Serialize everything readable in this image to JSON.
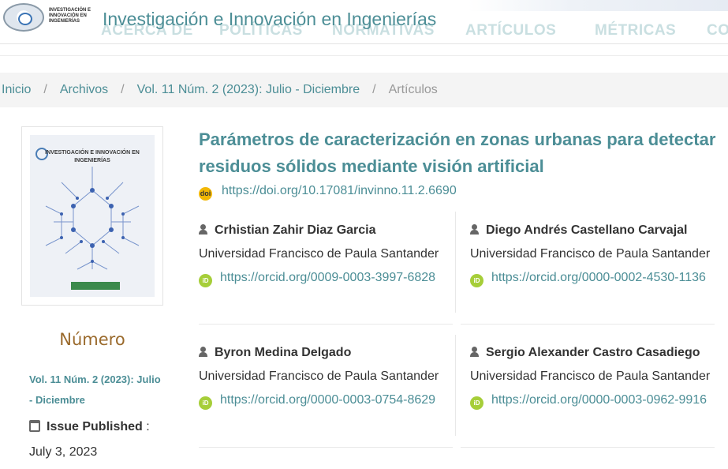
{
  "header": {
    "logo_text": "INVESTIGACIÓN E INNOVACIÓN EN INGENIERÍAS",
    "site_title": "Investigación e Innovación en Ingenierías",
    "nav": [
      "ACERCA DE",
      "POLÍTICAS",
      "NORMATIVAS",
      "ARTÍCULOS",
      "MÉTRICAS",
      "CO"
    ]
  },
  "breadcrumb": {
    "items": [
      "Inicio",
      "Archivos",
      "Vol. 11 Núm. 2 (2023): Julio - Diciembre"
    ],
    "separator": "/",
    "current": "Artículos"
  },
  "sidebar": {
    "cover_title": "INVESTIGACIÓN E INNOVACIÓN EN INGENIERÍAS",
    "issue_heading": "Número",
    "issue_link": "Vol. 11 Núm. 2 (2023): Julio - Diciembre",
    "published_label": "Issue Published",
    "published_colon": ":",
    "published_date": "July 3, 2023"
  },
  "article": {
    "title": "Parámetros de caracterización en zonas urbanas para detectar residuos sólidos mediante visión artificial",
    "doi": "https://doi.org/10.17081/invinno.11.2.6690",
    "doi_icon": "doi",
    "orcid_icon": "iD",
    "authors": [
      {
        "name": "Crhistian Zahir Diaz Garcia",
        "affiliation": "Universidad Francisco de Paula Santander",
        "orcid": "https://orcid.org/0009-0003-3997-6828"
      },
      {
        "name": "Diego Andrés Castellano Carvajal",
        "affiliation": "Universidad Francisco de Paula Santander",
        "orcid": "https://orcid.org/0000-0002-4530-1136"
      },
      {
        "name": "Byron Medina Delgado",
        "affiliation": "Universidad Francisco de Paula Santander",
        "orcid": "https://orcid.org/0000-0003-0754-8629"
      },
      {
        "name": "Sergio Alexander Castro Casadiego",
        "affiliation": "Universidad Francisco de Paula Santander",
        "orcid": "https://orcid.org/0000-0003-0962-9916"
      }
    ]
  },
  "colors": {
    "accent": "#4c8e96",
    "heading_gold": "#9a6a2c",
    "orcid_green": "#a6ce39",
    "doi_yellow": "#f2b705"
  }
}
